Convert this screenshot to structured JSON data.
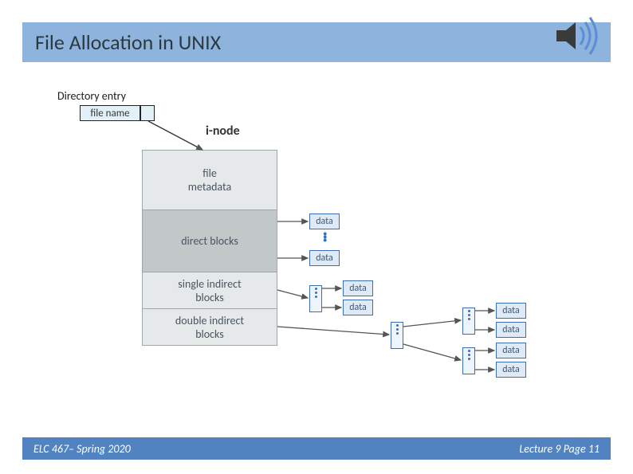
{
  "title": "File Allocation in UNIX",
  "directoryEntryLabel": "Directory entry",
  "fileName": "file name",
  "inodeLabel": "i-node",
  "inode": {
    "metadata": "file\nmetadata",
    "direct": "direct blocks",
    "single": "single indirect\nblocks",
    "double": "double indirect\nblocks"
  },
  "dataLabel": "data",
  "footerLeft": "ELC 467– Spring 2020",
  "footerRight": "Lecture 9 Page 11"
}
